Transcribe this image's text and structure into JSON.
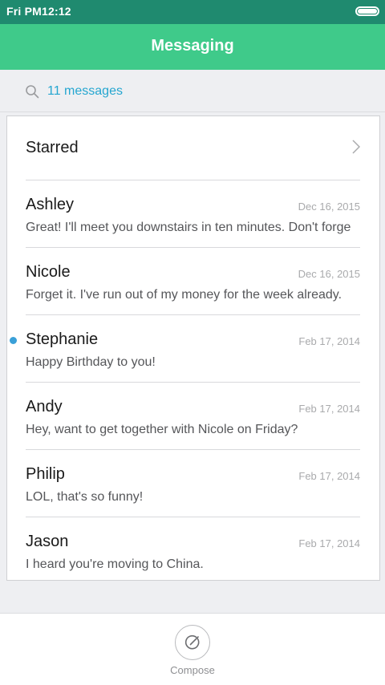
{
  "status_bar": {
    "time": "Fri PM12:12",
    "battery_level": 1.0
  },
  "header": {
    "title": "Messaging",
    "color": "#3fca8a"
  },
  "search": {
    "icon": "search-icon",
    "label": "11 messages",
    "accent": "#25a6d0"
  },
  "starred": {
    "label": "Starred",
    "icon": "chevron-right-icon"
  },
  "messages": [
    {
      "name": "Ashley",
      "date": "Dec 16, 2015",
      "preview": "Great! I'll meet you downstairs in ten minutes. Don't forge",
      "unread": false
    },
    {
      "name": "Nicole",
      "date": "Dec 16, 2015",
      "preview": "Forget it. I've run out of my money for the week already.",
      "unread": false
    },
    {
      "name": "Stephanie",
      "date": "Feb 17, 2014",
      "preview": "Happy Birthday to you!",
      "unread": true
    },
    {
      "name": "Andy",
      "date": "Feb 17, 2014",
      "preview": "Hey, want to get together with Nicole on Friday?",
      "unread": false
    },
    {
      "name": "Philip",
      "date": "Feb 17, 2014",
      "preview": "LOL, that's so funny!",
      "unread": false
    },
    {
      "name": "Jason",
      "date": "Feb 17, 2014",
      "preview": "I heard you're moving to China.",
      "unread": false
    }
  ],
  "compose": {
    "label": "Compose",
    "icon": "compose-icon"
  }
}
